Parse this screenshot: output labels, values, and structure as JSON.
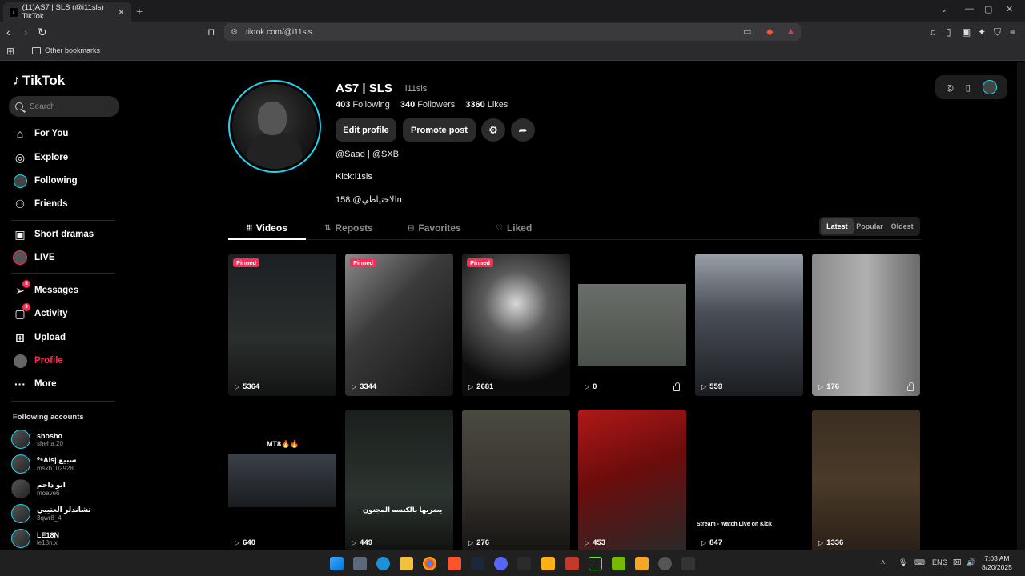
{
  "browser": {
    "tab_title": "(11)AS7 | SLS (@i11sls) | TikTok",
    "url": "tiktok.com/@i11sls",
    "bookmark_folder": "Other bookmarks",
    "new_tab": "+",
    "tab_close": "✕"
  },
  "sidebar": {
    "brand": "TikTok",
    "search_placeholder": "Search",
    "items": [
      {
        "label": "For You",
        "icon": "home-icon"
      },
      {
        "label": "Explore",
        "icon": "compass-icon"
      },
      {
        "label": "Following",
        "icon": "following-avatar-icon"
      },
      {
        "label": "Friends",
        "icon": "friends-icon"
      },
      {
        "label": "Short dramas",
        "icon": "film-icon"
      },
      {
        "label": "LIVE",
        "icon": "live-avatar-icon"
      },
      {
        "label": "Messages",
        "icon": "send-icon",
        "badge": "8"
      },
      {
        "label": "Activity",
        "icon": "chat-icon",
        "badge": "3"
      },
      {
        "label": "Upload",
        "icon": "plus-square-icon"
      },
      {
        "label": "Profile",
        "icon": "profile-avatar-icon"
      },
      {
        "label": "More",
        "icon": "ellipsis-icon"
      }
    ],
    "following_title": "Following accounts",
    "following": [
      {
        "name": "shosho",
        "user": "sheha.20"
      },
      {
        "name": "⁰⁶Als| سبيع",
        "user": "msxb102928"
      },
      {
        "name": "ابو داحم",
        "user": "moave6"
      },
      {
        "name": "تشاندلر العتيبي",
        "user": "3qwr8_4"
      },
      {
        "name": "LE18N",
        "user": "le18n.x"
      }
    ]
  },
  "profile": {
    "name": "AS7 | SLS",
    "handle": "i11sls",
    "following_count": "403",
    "following_label": "Following",
    "followers_count": "340",
    "followers_label": "Followers",
    "likes_count": "3360",
    "likes_label": "Likes",
    "edit_label": "Edit profile",
    "promote_label": "Promote post",
    "bio_line1": "@Saad | @SXB",
    "bio_line2": "Kick:i1sls",
    "bio_line3": "158.@الاحتياطيn"
  },
  "tabs": [
    {
      "label": "Videos",
      "icon": "grid-icon"
    },
    {
      "label": "Reposts",
      "icon": "repost-icon"
    },
    {
      "label": "Favorites",
      "icon": "bookmark-icon"
    },
    {
      "label": "Liked",
      "icon": "heart-icon"
    }
  ],
  "sort": {
    "latest": "Latest",
    "popular": "Popular",
    "oldest": "Oldest"
  },
  "pinned_label": "Pinned",
  "videos": [
    {
      "views": "5364",
      "pinned": true
    },
    {
      "views": "3344",
      "pinned": true
    },
    {
      "views": "2681",
      "pinned": true
    },
    {
      "views": "0",
      "locked": true
    },
    {
      "views": "559"
    },
    {
      "views": "176",
      "locked": true
    },
    {
      "views": "640",
      "caption": "MT8🔥🔥"
    },
    {
      "views": "449",
      "caption": "يضربها بالكتسه المجنون"
    },
    {
      "views": "276"
    },
    {
      "views": "453"
    },
    {
      "views": "847",
      "caption": "Stream - Watch Live on Kick"
    },
    {
      "views": "1336"
    }
  ],
  "taskbar": {
    "lang": "ENG",
    "time": "7:03 AM",
    "date": "8/20/2025"
  }
}
